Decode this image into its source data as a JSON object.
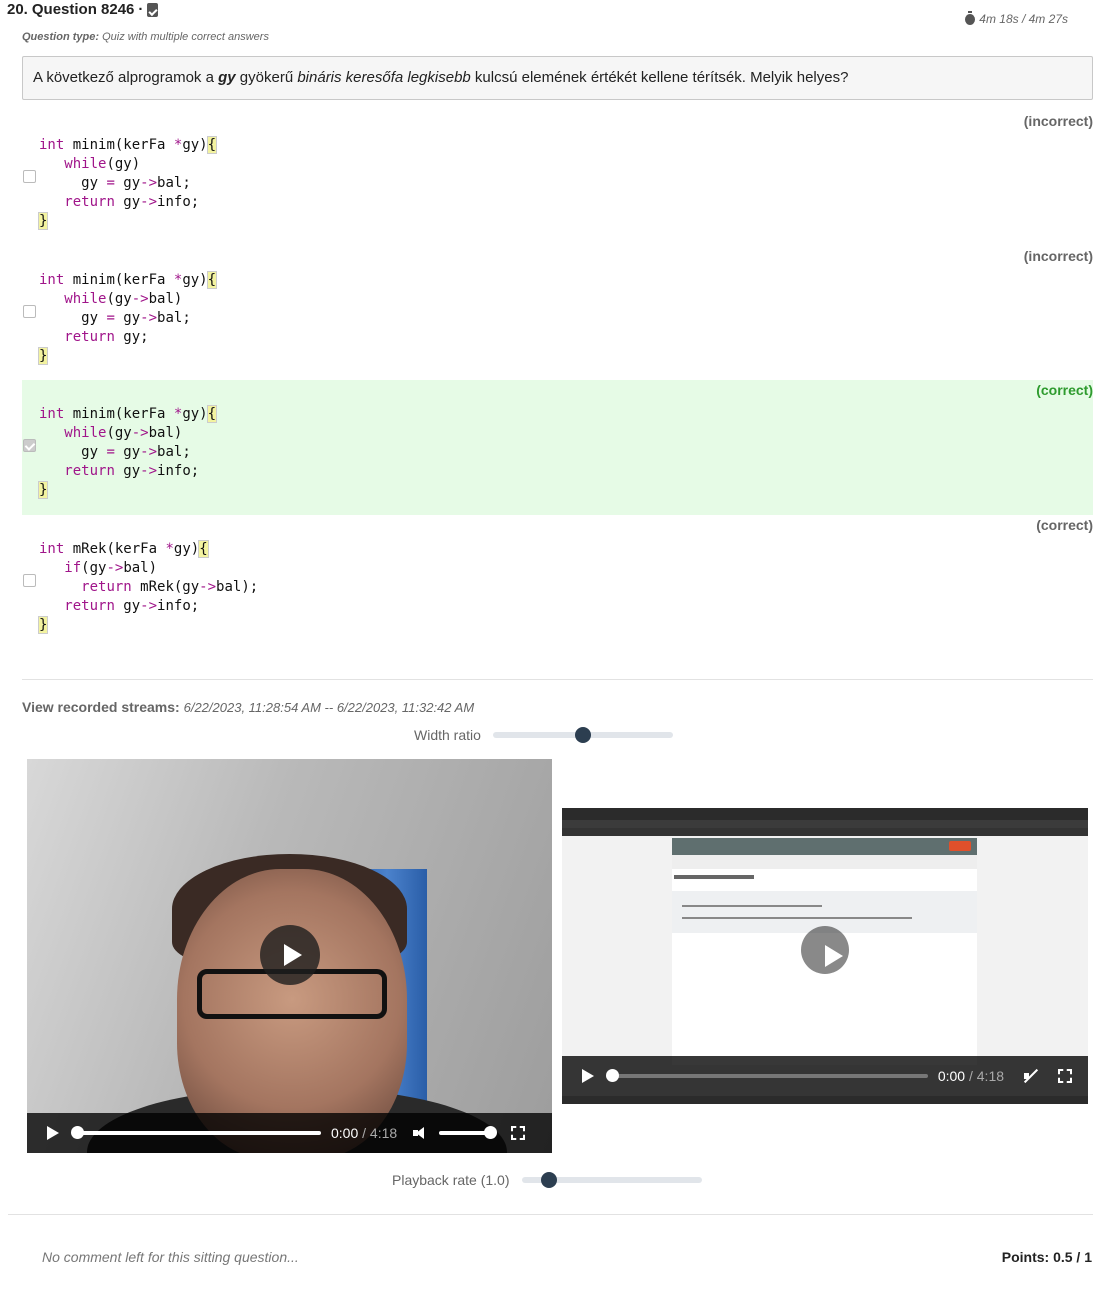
{
  "question": {
    "number": "20.",
    "title": "Question 8246",
    "separator": "·",
    "timer": "4m 18s / 4m 27s",
    "type_label": "Question type:",
    "type_value": "Quiz with multiple correct answers",
    "stem_parts": {
      "p1": "A következő alprogramok a ",
      "p2": "gy",
      "p3": " gyökerű ",
      "p4": "bináris keresőfa legkisebb",
      "p5": " kulcsú elemének értékét kellene térítsék. Melyik helyes?"
    }
  },
  "options": [
    {
      "status": "(incorrect)",
      "checked": false,
      "code": [
        [
          {
            "t": "kw",
            "v": "int"
          },
          {
            "t": "",
            "v": " minim(kerFa "
          },
          {
            "t": "op",
            "v": "*"
          },
          {
            "t": "",
            "v": "gy)"
          },
          {
            "t": "br",
            "v": "{"
          }
        ],
        [
          {
            "t": "",
            "v": "   "
          },
          {
            "t": "kw",
            "v": "while"
          },
          {
            "t": "",
            "v": "(gy)"
          }
        ],
        [
          {
            "t": "",
            "v": "     gy "
          },
          {
            "t": "op",
            "v": "="
          },
          {
            "t": "",
            "v": " gy"
          },
          {
            "t": "op",
            "v": "->"
          },
          {
            "t": "",
            "v": "bal;"
          }
        ],
        [
          {
            "t": "",
            "v": "   "
          },
          {
            "t": "kw",
            "v": "return"
          },
          {
            "t": "",
            "v": " gy"
          },
          {
            "t": "op",
            "v": "->"
          },
          {
            "t": "",
            "v": "info;"
          }
        ],
        [
          {
            "t": "br",
            "v": "}"
          }
        ]
      ]
    },
    {
      "status": "(incorrect)",
      "checked": false,
      "code": [
        [
          {
            "t": "kw",
            "v": "int"
          },
          {
            "t": "",
            "v": " minim(kerFa "
          },
          {
            "t": "op",
            "v": "*"
          },
          {
            "t": "",
            "v": "gy)"
          },
          {
            "t": "br",
            "v": "{"
          }
        ],
        [
          {
            "t": "",
            "v": "   "
          },
          {
            "t": "kw",
            "v": "while"
          },
          {
            "t": "",
            "v": "(gy"
          },
          {
            "t": "op",
            "v": "->"
          },
          {
            "t": "",
            "v": "bal)"
          }
        ],
        [
          {
            "t": "",
            "v": "     gy "
          },
          {
            "t": "op",
            "v": "="
          },
          {
            "t": "",
            "v": " gy"
          },
          {
            "t": "op",
            "v": "->"
          },
          {
            "t": "",
            "v": "bal;"
          }
        ],
        [
          {
            "t": "",
            "v": "   "
          },
          {
            "t": "kw",
            "v": "return"
          },
          {
            "t": "",
            "v": " gy;"
          }
        ],
        [
          {
            "t": "br",
            "v": "}"
          }
        ]
      ]
    },
    {
      "status": "(correct)",
      "checked": true,
      "code": [
        [
          {
            "t": "kw",
            "v": "int"
          },
          {
            "t": "",
            "v": " minim(kerFa "
          },
          {
            "t": "op",
            "v": "*"
          },
          {
            "t": "",
            "v": "gy)"
          },
          {
            "t": "br",
            "v": "{"
          }
        ],
        [
          {
            "t": "",
            "v": "   "
          },
          {
            "t": "kw",
            "v": "while"
          },
          {
            "t": "",
            "v": "(gy"
          },
          {
            "t": "op",
            "v": "->"
          },
          {
            "t": "",
            "v": "bal)"
          }
        ],
        [
          {
            "t": "",
            "v": "     gy "
          },
          {
            "t": "op",
            "v": "="
          },
          {
            "t": "",
            "v": " gy"
          },
          {
            "t": "op",
            "v": "->"
          },
          {
            "t": "",
            "v": "bal;"
          }
        ],
        [
          {
            "t": "",
            "v": "   "
          },
          {
            "t": "kw",
            "v": "return"
          },
          {
            "t": "",
            "v": " gy"
          },
          {
            "t": "op",
            "v": "->"
          },
          {
            "t": "",
            "v": "info;"
          }
        ],
        [
          {
            "t": "br",
            "v": "}"
          }
        ]
      ]
    },
    {
      "status": "(correct)",
      "checked": false,
      "code": [
        [
          {
            "t": "kw",
            "v": "int"
          },
          {
            "t": "",
            "v": " mRek(kerFa "
          },
          {
            "t": "op",
            "v": "*"
          },
          {
            "t": "",
            "v": "gy)"
          },
          {
            "t": "br",
            "v": "{"
          }
        ],
        [
          {
            "t": "",
            "v": "   "
          },
          {
            "t": "kw",
            "v": "if"
          },
          {
            "t": "",
            "v": "(gy"
          },
          {
            "t": "op",
            "v": "->"
          },
          {
            "t": "",
            "v": "bal)"
          }
        ],
        [
          {
            "t": "",
            "v": "     "
          },
          {
            "t": "kw",
            "v": "return"
          },
          {
            "t": "",
            "v": " mRek(gy"
          },
          {
            "t": "op",
            "v": "->"
          },
          {
            "t": "",
            "v": "bal);"
          }
        ],
        [
          {
            "t": "",
            "v": "   "
          },
          {
            "t": "kw",
            "v": "return"
          },
          {
            "t": "",
            "v": " gy"
          },
          {
            "t": "op",
            "v": "->"
          },
          {
            "t": "",
            "v": "info;"
          }
        ],
        [
          {
            "t": "br",
            "v": "}"
          }
        ]
      ]
    }
  ],
  "streams": {
    "label": "View recorded streams:",
    "range": "6/22/2023, 11:28:54 AM -- 6/22/2023, 11:32:42 AM",
    "width_ratio_label": "Width ratio",
    "width_ratio_value": 0.5,
    "playback_rate_label": "Playback rate (1.0)",
    "playback_rate_value": 0.15,
    "videos": [
      {
        "current": "0:00",
        "duration": "/ 4:18"
      },
      {
        "current": "0:00",
        "duration": "/ 4:18"
      }
    ]
  },
  "footer": {
    "comment": "No comment left for this sitting question...",
    "points": "Points: 0.5 / 1"
  },
  "colors": {
    "correct_bg": "#e6fbe6",
    "correct_text": "#2e9b2e",
    "keyword": "#a0158a",
    "slider_thumb": "#2c3e50"
  }
}
